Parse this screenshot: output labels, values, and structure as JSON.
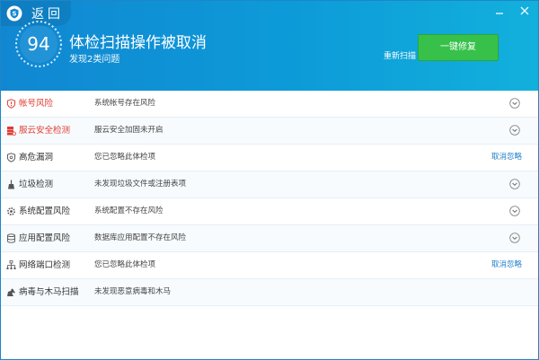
{
  "header": {
    "back_label": "返回",
    "score": "94",
    "title": "体检扫描操作被取消",
    "subtitle": "发现2类问题",
    "rescan_label": "重新扫描",
    "fix_button_label": "一键修复"
  },
  "colors": {
    "header_blue": "#1187d2",
    "fix_green": "#38c14a",
    "danger_red": "#e03c31",
    "link_blue": "#1f7fc9"
  },
  "items": [
    {
      "name": "帐号风险",
      "desc": "系统帐号存在风险",
      "status": "danger",
      "icon": "shield-icon",
      "action": ""
    },
    {
      "name": "服云安全检测",
      "desc": "服云安全加固未开启",
      "status": "danger",
      "icon": "server-icon",
      "action": ""
    },
    {
      "name": "高危漏洞",
      "desc": "您已忽略此体检项",
      "status": "normal",
      "icon": "shield-outline-icon",
      "action": "取消忽略"
    },
    {
      "name": "垃圾检测",
      "desc": "未发现垃圾文件或注册表项",
      "status": "normal",
      "icon": "broom-icon",
      "action": ""
    },
    {
      "name": "系统配置风险",
      "desc": "系统配置不存在风险",
      "status": "normal",
      "icon": "gear-icon",
      "action": ""
    },
    {
      "name": "应用配置风险",
      "desc": "数据库应用配置不存在风险",
      "status": "normal",
      "icon": "database-icon",
      "action": ""
    },
    {
      "name": "网络端口检测",
      "desc": "您已忽略此体检项",
      "status": "normal",
      "icon": "network-icon",
      "action": "取消忽略"
    },
    {
      "name": "病毒与木马扫描",
      "desc": "未发现恶意病毒和木马",
      "status": "normal",
      "icon": "horse-icon",
      "action": ""
    }
  ]
}
